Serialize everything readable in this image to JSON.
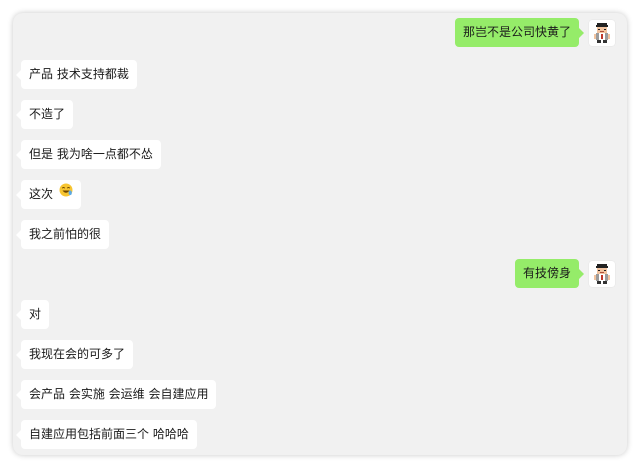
{
  "messages": [
    {
      "side": "right",
      "text": "那岂不是公司快黄了"
    },
    {
      "side": "left",
      "text": "产品  技术支持都裁"
    },
    {
      "side": "left",
      "text": "不造了"
    },
    {
      "side": "left",
      "text": "但是 我为啥一点都不怂"
    },
    {
      "side": "left",
      "text": "这次",
      "emoji": "laughing-emoji"
    },
    {
      "side": "left",
      "text": "我之前怕的很"
    },
    {
      "side": "right",
      "text": "有技傍身"
    },
    {
      "side": "left",
      "text": "对"
    },
    {
      "side": "left",
      "text": "我现在会的可多了"
    },
    {
      "side": "left",
      "text": "会产品  会实施  会运维  会自建应用"
    },
    {
      "side": "left",
      "text": "自建应用包括前面三个  哈哈哈"
    }
  ],
  "colors": {
    "outgoing_bubble": "#95ec69",
    "incoming_bubble": "#ffffff",
    "chat_background": "#f1f1f1"
  },
  "icons": {
    "avatar": "pixel-character-avatar-icon",
    "emoji": "laughing-emoji"
  }
}
